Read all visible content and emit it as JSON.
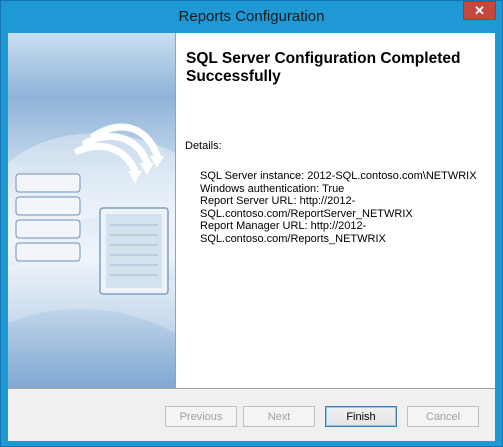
{
  "window": {
    "title": "Reports Configuration",
    "close_icon": "close-icon"
  },
  "main": {
    "heading": "SQL Server Configuration Completed Successfully",
    "details_label": "Details:",
    "details_lines": [
      "SQL Server instance: 2012-SQL.contoso.com\\NETWRIX",
      "Windows authentication: True",
      "Report Server URL: http://2012-",
      "SQL.contoso.com/ReportServer_NETWRIX",
      "Report Manager URL: http://2012-",
      "SQL.contoso.com/Reports_NETWRIX"
    ]
  },
  "buttons": {
    "previous": "Previous",
    "next": "Next",
    "finish": "Finish",
    "cancel": "Cancel"
  },
  "colors": {
    "frame": "#1f98d6",
    "close_button": "#c7463e"
  },
  "illustration": {
    "icon": "database-to-report-graphic"
  }
}
